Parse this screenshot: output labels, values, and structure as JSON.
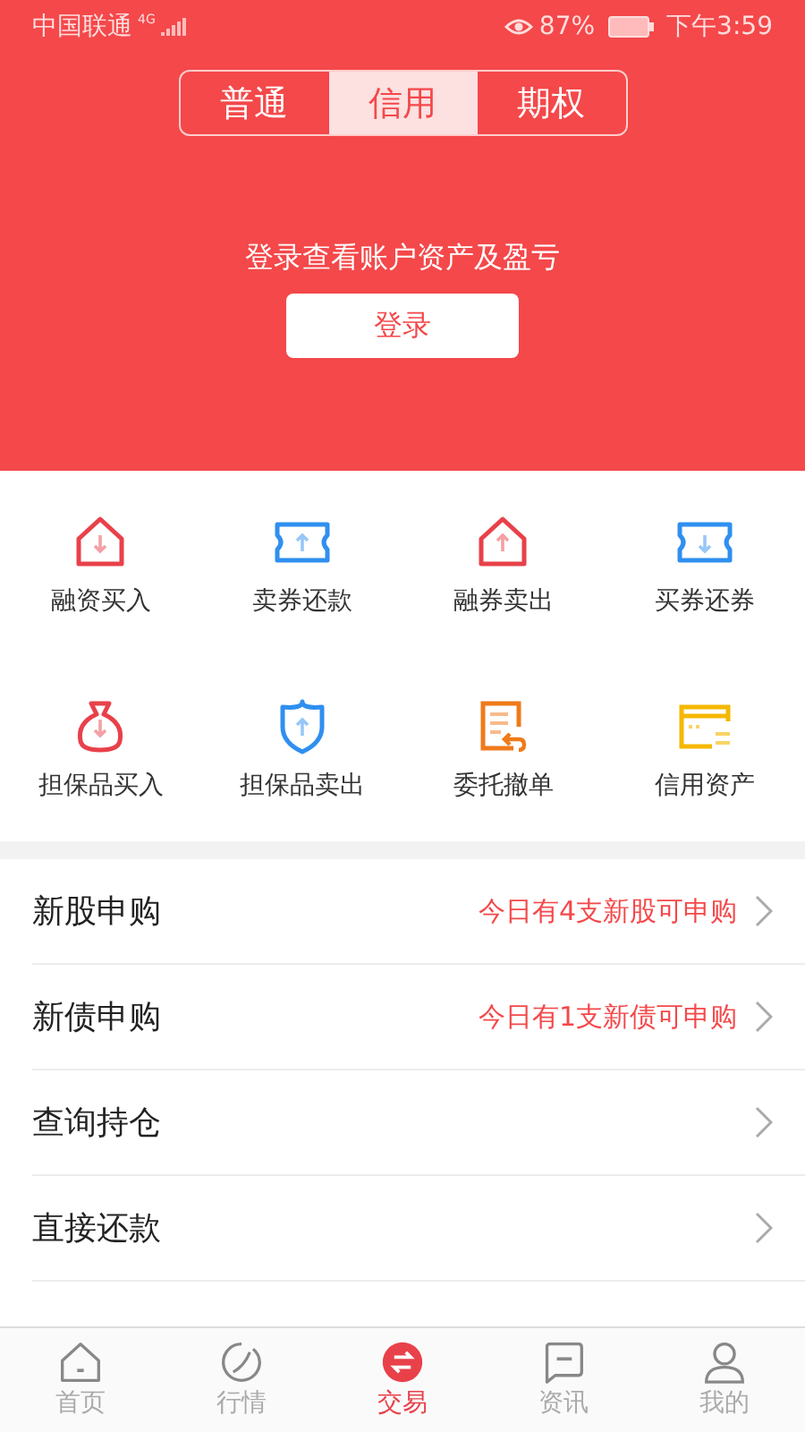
{
  "status_bar": {
    "carrier": "中国联通",
    "network": "4G",
    "battery": "87%",
    "time": "下午3:59"
  },
  "tabs": [
    {
      "label": "普通",
      "selected": false
    },
    {
      "label": "信用",
      "selected": true
    },
    {
      "label": "期权",
      "selected": false
    }
  ],
  "login_prompt": "登录查看账户资产及盈亏",
  "login_button": "登录",
  "actions": [
    {
      "label": "融资买入",
      "kind": "house-down",
      "color": "#e8414a"
    },
    {
      "label": "卖券还款",
      "kind": "ticket-up",
      "color": "#2f8ff0"
    },
    {
      "label": "融券卖出",
      "kind": "house-up",
      "color": "#e8414a"
    },
    {
      "label": "买券还券",
      "kind": "ticket-down",
      "color": "#2f8ff0"
    },
    {
      "label": "担保品买入",
      "kind": "bag",
      "color": "#e8414a"
    },
    {
      "label": "担保品卖出",
      "kind": "shield",
      "color": "#2f8ff0"
    },
    {
      "label": "委托撤单",
      "kind": "document",
      "color": "#f07a1a"
    },
    {
      "label": "信用资产",
      "kind": "card",
      "color": "#f5b800"
    }
  ],
  "menu": [
    {
      "label": "新股申购",
      "note": "今日有4支新股可申购"
    },
    {
      "label": "新债申购",
      "note": "今日有1支新债可申购"
    },
    {
      "label": "查询持仓"
    },
    {
      "label": "直接还款"
    }
  ],
  "bottom_nav": [
    {
      "label": "首页",
      "kind": "home",
      "selected": false
    },
    {
      "label": "行情",
      "kind": "market",
      "selected": false
    },
    {
      "label": "交易",
      "kind": "trade",
      "selected": true
    },
    {
      "label": "资讯",
      "kind": "news",
      "selected": false
    },
    {
      "label": "我的",
      "kind": "profile",
      "selected": false
    }
  ]
}
